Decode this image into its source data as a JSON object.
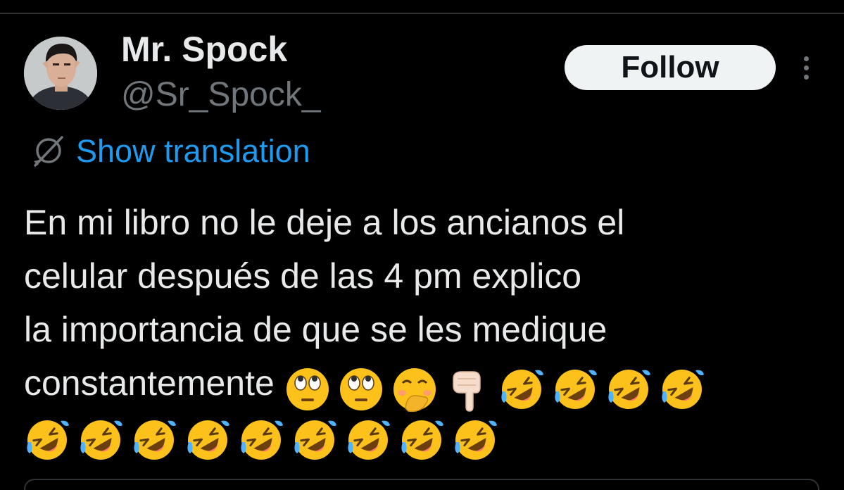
{
  "author": {
    "display_name": "Mr. Spock",
    "handle": "@Sr_Spock_",
    "avatar_icon": "user-photo-avatar"
  },
  "actions": {
    "follow_label": "Follow",
    "more_icon": "more-vertical-icon"
  },
  "translation": {
    "label": "Show translation",
    "icon": "translate-globe-icon",
    "color": "#1d9bf0"
  },
  "tweet": {
    "lines": [
      "En mi libro no le deje a los ancianos el",
      "celular después de las 4 pm explico",
      "la importancia de que se les medique",
      "constantemente"
    ],
    "emojis_line4": [
      "face-with-rolling-eyes",
      "face-with-rolling-eyes",
      "face-with-hand-over-mouth",
      "backhand-index-pointing-down",
      "rolling-on-the-floor-laughing",
      "rolling-on-the-floor-laughing",
      "rolling-on-the-floor-laughing",
      "rolling-on-the-floor-laughing"
    ],
    "emojis_line5": [
      "rolling-on-the-floor-laughing",
      "rolling-on-the-floor-laughing",
      "rolling-on-the-floor-laughing",
      "rolling-on-the-floor-laughing",
      "rolling-on-the-floor-laughing",
      "rolling-on-the-floor-laughing",
      "rolling-on-the-floor-laughing",
      "rolling-on-the-floor-laughing",
      "rolling-on-the-floor-laughing"
    ]
  },
  "colors": {
    "background": "#000000",
    "text_primary": "#e7e9ea",
    "text_secondary": "#71767b",
    "link": "#1d9bf0",
    "divider": "#2f3336"
  }
}
